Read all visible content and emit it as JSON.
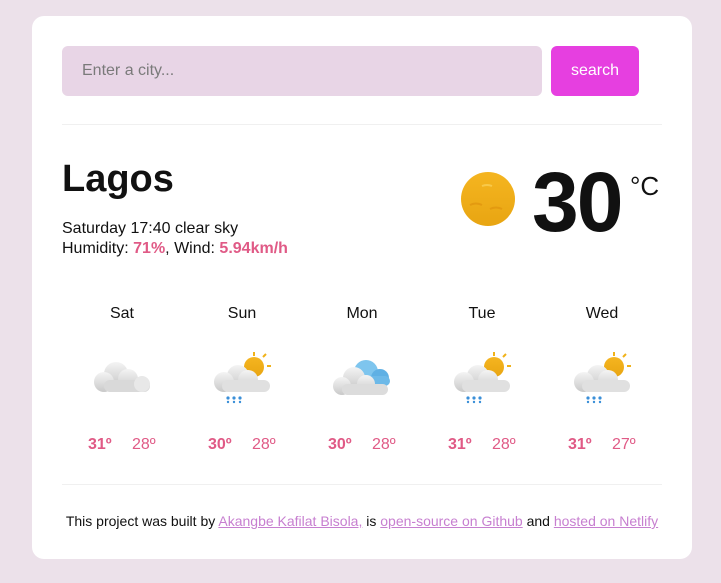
{
  "search": {
    "placeholder": "Enter a city...",
    "value": "",
    "button_label": "search"
  },
  "current": {
    "city": "Lagos",
    "day_time": "Saturday 17:40",
    "description": "clear sky",
    "humidity_label": "Humidity:",
    "humidity_value": "71%",
    "wind_label": "Wind:",
    "wind_value": "5.94km/h",
    "temperature": "30",
    "unit": "°C",
    "icon": "clear-sky-icon"
  },
  "forecast": [
    {
      "day": "Sat",
      "icon": "cloudy-icon",
      "max": "31º",
      "min": "28º"
    },
    {
      "day": "Sun",
      "icon": "rain-icon",
      "max": "30º",
      "min": "28º"
    },
    {
      "day": "Mon",
      "icon": "overcast-clouds-icon",
      "max": "30º",
      "min": "28º"
    },
    {
      "day": "Tue",
      "icon": "rain-icon",
      "max": "31º",
      "min": "28º"
    },
    {
      "day": "Wed",
      "icon": "rain-icon",
      "max": "31º",
      "min": "27º"
    }
  ],
  "footer": {
    "text_before": "This project was built by",
    "author_link": "Akangbe Kafilat Bisola,",
    "text_is": "is",
    "github_link": "open-source on Github",
    "text_and": "and",
    "netlify_link": "hosted on Netlify"
  },
  "colors": {
    "accent": "#e63fe0",
    "highlight": "#e05a86",
    "input_bg": "#e8d5e6",
    "page_bg": "#ece1ea",
    "link": "#c77fd0"
  }
}
